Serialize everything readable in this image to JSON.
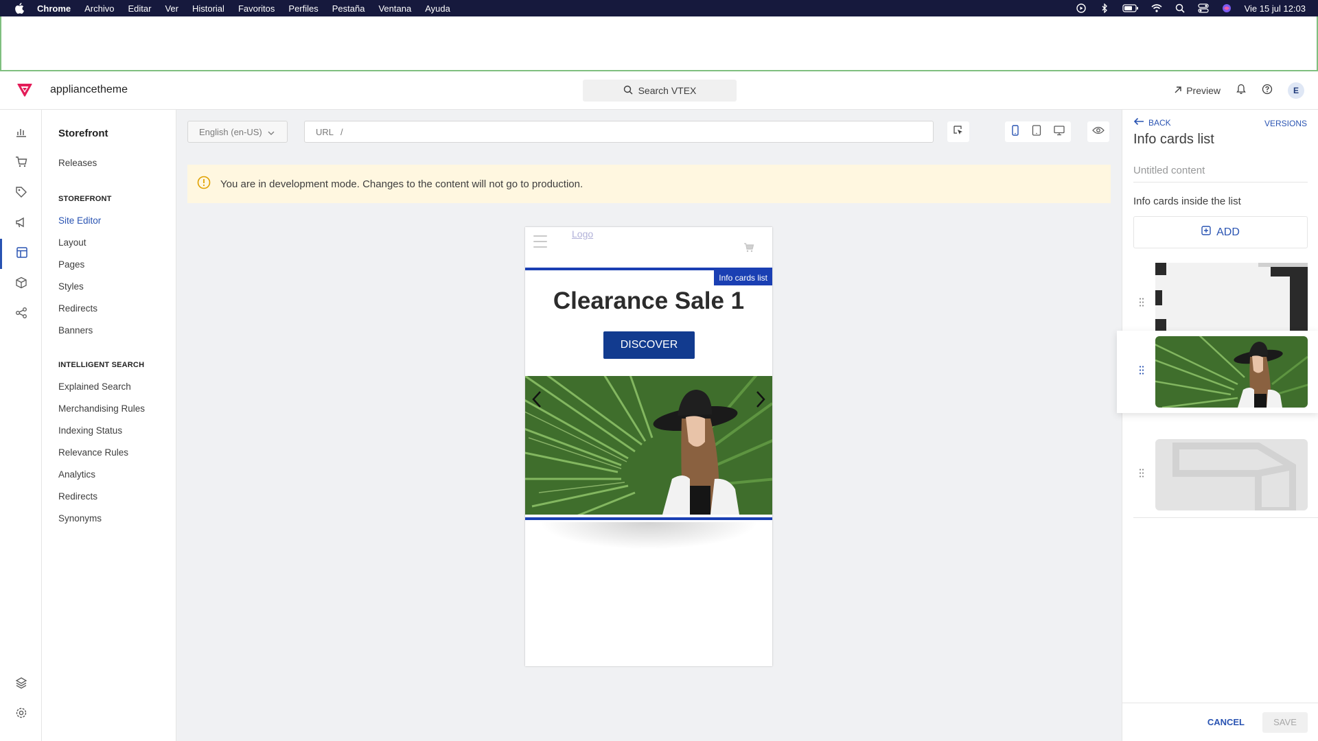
{
  "menubar": {
    "app": "Chrome",
    "items": [
      "Archivo",
      "Editar",
      "Ver",
      "Historial",
      "Favoritos",
      "Perfiles",
      "Pestaña",
      "Ventana",
      "Ayuda"
    ],
    "clock": "Vie 15 jul  12:03"
  },
  "header": {
    "store_name": "appliancetheme",
    "search_label": "Search VTEX",
    "preview_label": "Preview",
    "avatar_initial": "E"
  },
  "nav": {
    "title": "Storefront",
    "releases": "Releases",
    "storefront_section": "STOREFRONT",
    "storefront_items": [
      "Site Editor",
      "Layout",
      "Pages",
      "Styles",
      "Redirects",
      "Banners"
    ],
    "search_section": "INTELLIGENT SEARCH",
    "search_items": [
      "Explained Search",
      "Merchandising Rules",
      "Indexing Status",
      "Relevance Rules",
      "Analytics",
      "Redirects",
      "Synonyms"
    ]
  },
  "editor": {
    "language": "English (en-US)",
    "url_label": "URL",
    "url_value": "/",
    "dev_alert": "You are in development mode. Changes to the content will not go to production."
  },
  "preview": {
    "logo_alt": "Logo",
    "selection_tag": "Info cards list",
    "card_title": "Clearance Sale 1",
    "cta": "DISCOVER"
  },
  "panel": {
    "back": "BACK",
    "versions": "VERSIONS",
    "title": "Info cards list",
    "untitled_placeholder": "Untitled content",
    "list_label": "Info cards inside the list",
    "add_label": "ADD",
    "cancel": "CANCEL",
    "save": "SAVE"
  },
  "colors": {
    "accent": "#2953b2",
    "selection": "#1a3fb3",
    "cta": "#123b8f",
    "alert_bg": "#fff7e0",
    "brand": "#e31c58"
  }
}
